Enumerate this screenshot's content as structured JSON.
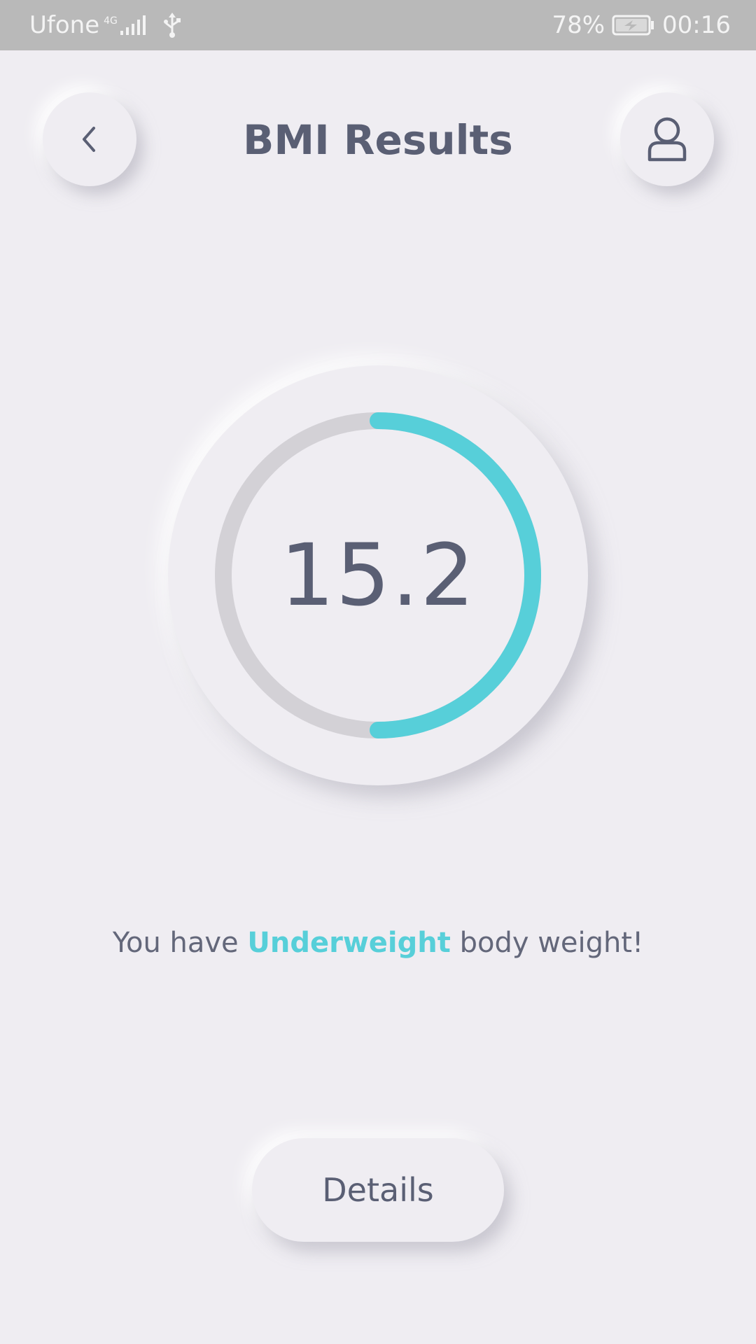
{
  "status_bar": {
    "carrier": "Ufone",
    "network_type": "4G",
    "battery_percent": "78%",
    "time": "00:16",
    "icons": [
      "signal-icon",
      "usb-icon",
      "battery-charging-icon"
    ]
  },
  "header": {
    "title": "BMI Results",
    "back_icon": "chevron-left-icon",
    "profile_icon": "user-icon"
  },
  "gauge": {
    "value": "15.2",
    "progress_fraction": 0.5,
    "progress_color": "#57cfd9",
    "track_color": "#d3d1d6"
  },
  "result": {
    "prefix": "You have",
    "category": "Underweight",
    "suffix": "body weight!"
  },
  "actions": {
    "details_label": "Details"
  },
  "colors": {
    "background": "#efedf2",
    "text": "#5a5f74",
    "accent": "#57cfd9"
  }
}
